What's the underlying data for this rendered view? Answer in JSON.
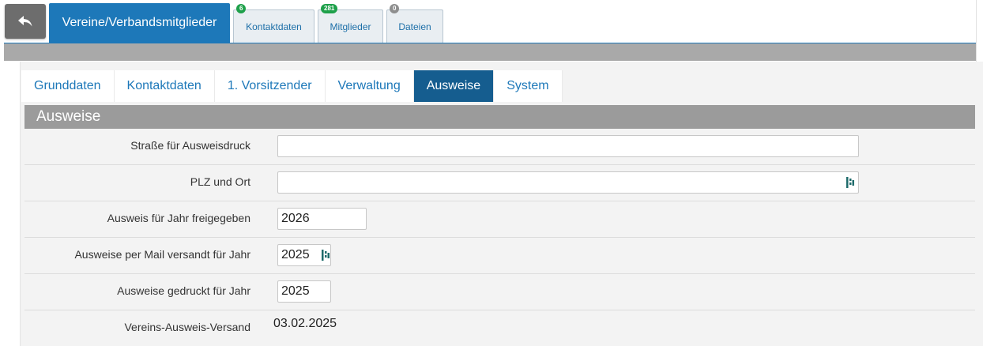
{
  "top": {
    "main_tab": "Vereine/Verbandsmitglieder",
    "sub_tabs": [
      {
        "label": "Kontaktdaten",
        "badge": "6",
        "badge_color": "#1ea04a"
      },
      {
        "label": "Mitglieder",
        "badge": "281",
        "badge_color": "#1ea04a"
      },
      {
        "label": "Dateien",
        "badge": "0",
        "badge_color": "#8e8e8e"
      }
    ]
  },
  "tabs": [
    "Grunddaten",
    "Kontaktdaten",
    "1. Vorsitzender",
    "Verwaltung",
    "Ausweise",
    "System"
  ],
  "active_tab": "Ausweise",
  "section": {
    "title": "Ausweise"
  },
  "form": {
    "strasse": {
      "label": "Straße für Ausweisdruck",
      "value": ""
    },
    "plz_ort": {
      "label": "PLZ und Ort",
      "value": ""
    },
    "jahr_freigegeben": {
      "label": "Ausweis für Jahr freigegeben",
      "value": "2026"
    },
    "mail_versandt": {
      "label": "Ausweise per Mail versandt für Jahr",
      "value": "2025"
    },
    "gedruckt": {
      "label": "Ausweise gedruckt für Jahr",
      "value": "2025"
    },
    "versand": {
      "label": "Vereins-Ausweis-Versand",
      "value": "03.02.2025"
    }
  },
  "colors": {
    "primary": "#1d78b9",
    "active_tab": "#155d8f",
    "section_head": "#9b9b9b"
  }
}
